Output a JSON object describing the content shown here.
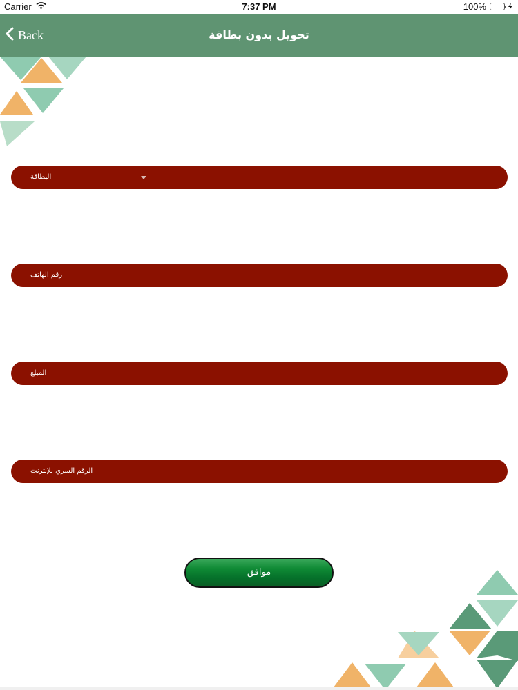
{
  "status_bar": {
    "carrier": "Carrier",
    "time": "7:37 PM",
    "battery": "100%"
  },
  "nav": {
    "back_label": "Back",
    "title": "تحويل بدون بطاقة"
  },
  "form": {
    "card_label": "البطاقة",
    "phone_label": "رقم الهاتف",
    "amount_label": "المبلغ",
    "pin_label": "الرقم السري للإنترنت"
  },
  "submit_label": "موافق",
  "colors": {
    "nav_bg": "#5f9472",
    "field_bg": "#8b1100",
    "button_green": "#0f8a35",
    "triangle_orange": "#f0b368",
    "triangle_green_light": "#8fcbb0",
    "triangle_green_dark": "#5a9a78"
  }
}
